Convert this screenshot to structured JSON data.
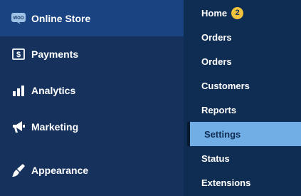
{
  "colors": {
    "sidebar_bg": "#16325c",
    "active_bg": "#1a4381",
    "submenu_bg": "#0f2c52",
    "selected_bg": "#72aee6",
    "badge_bg": "#f0c33c"
  },
  "sidebar": {
    "items": [
      {
        "label": "Online Store",
        "icon": "woo-icon",
        "active": true
      },
      {
        "label": "Payments",
        "icon": "dollar-icon"
      },
      {
        "label": "Analytics",
        "icon": "bar-chart-icon"
      },
      {
        "label": "Marketing",
        "icon": "megaphone-icon"
      },
      {
        "label": "Appearance",
        "icon": "paintbrush-icon"
      }
    ],
    "woo_icon_text": "WOO"
  },
  "submenu": {
    "items": [
      {
        "label": "Home",
        "badge": "2"
      },
      {
        "label": "Orders"
      },
      {
        "label": "Orders"
      },
      {
        "label": "Customers"
      },
      {
        "label": "Reports"
      },
      {
        "label": "Settings",
        "selected": true
      },
      {
        "label": "Status"
      },
      {
        "label": "Extensions"
      }
    ]
  }
}
